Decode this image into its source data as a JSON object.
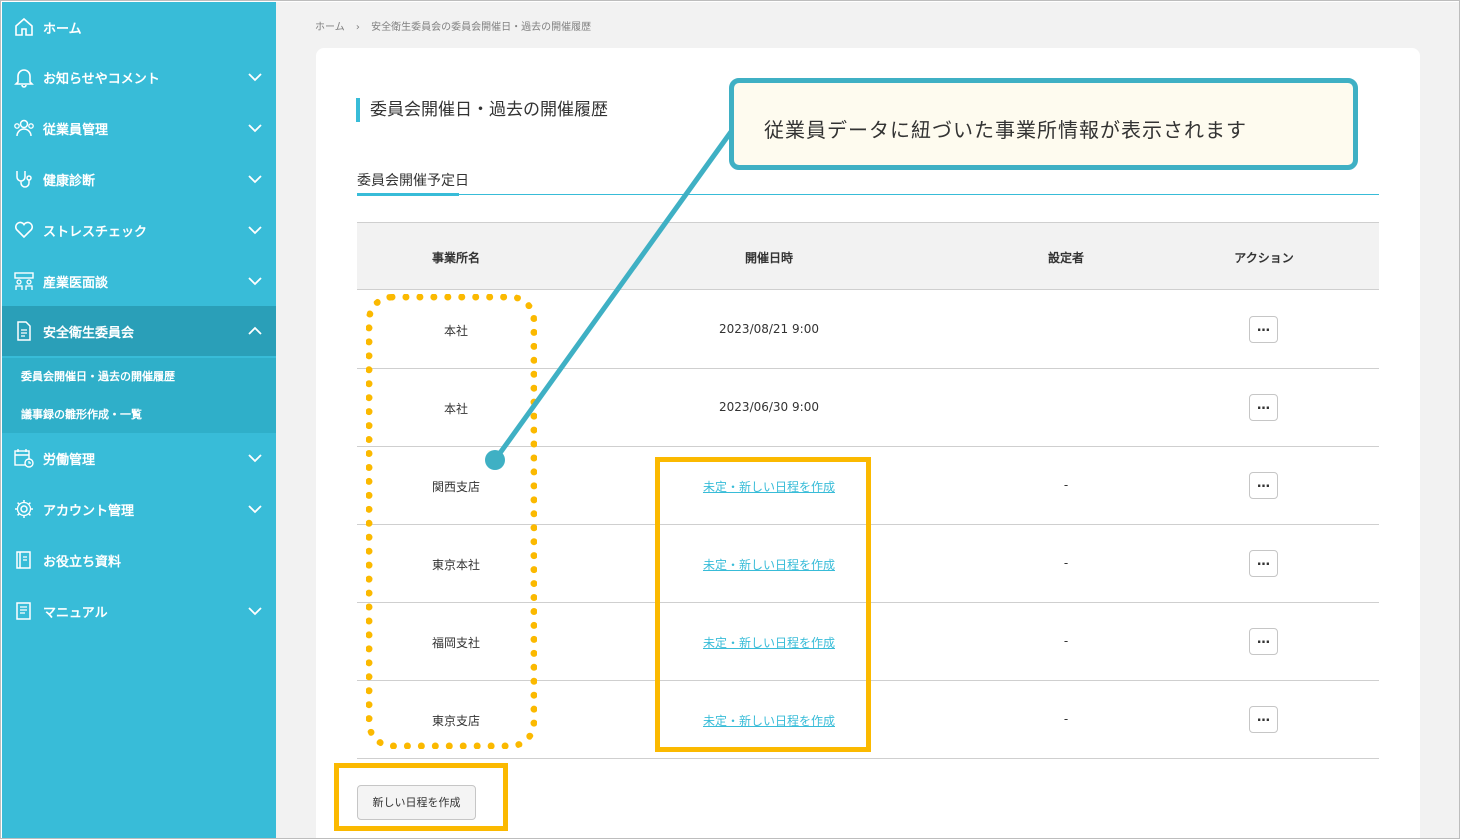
{
  "sidebar": {
    "items": [
      {
        "label": "ホーム",
        "icon": "home-icon"
      },
      {
        "label": "お知らせやコメント",
        "icon": "bell-icon"
      },
      {
        "label": "従業員管理",
        "icon": "users-icon"
      },
      {
        "label": "健康診断",
        "icon": "stethoscope-icon"
      },
      {
        "label": "ストレスチェック",
        "icon": "heart-icon"
      },
      {
        "label": "産業医面談",
        "icon": "meeting-icon"
      },
      {
        "label": "安全衛生委員会",
        "icon": "document-icon"
      },
      {
        "label": "労働管理",
        "icon": "calendar-clock-icon"
      },
      {
        "label": "アカウント管理",
        "icon": "gear-icon"
      },
      {
        "label": "お役立ち資料",
        "icon": "book-icon"
      },
      {
        "label": "マニュアル",
        "icon": "manual-icon"
      }
    ],
    "sub_items": [
      {
        "label": "委員会開催日・過去の開催履歴"
      },
      {
        "label": "議事録の雛形作成・一覧"
      }
    ]
  },
  "breadcrumb": {
    "home": "ホーム",
    "separator": "›",
    "current": "安全衛生委員会の委員会開催日・過去の開催履歴"
  },
  "page": {
    "title": "委員会開催日・過去の開催履歴",
    "section_title": "委員会開催予定日"
  },
  "table": {
    "headers": [
      "事業所名",
      "開催日時",
      "設定者",
      "アクション"
    ],
    "rows": [
      {
        "office": "本社",
        "datetime": "2023/08/21 9:00",
        "setter": "",
        "action": "…"
      },
      {
        "office": "本社",
        "datetime": "2023/06/30 9:00",
        "setter": "",
        "action": "…"
      },
      {
        "office": "関西支店",
        "datetime": "未定・新しい日程を作成",
        "setter": "-",
        "action": "…"
      },
      {
        "office": "東京本社",
        "datetime": "未定・新しい日程を作成",
        "setter": "-",
        "action": "…"
      },
      {
        "office": "福岡支社",
        "datetime": "未定・新しい日程を作成",
        "setter": "-",
        "action": "…"
      },
      {
        "office": "東京支店",
        "datetime": "未定・新しい日程を作成",
        "setter": "-",
        "action": "…"
      }
    ]
  },
  "new_schedule_button": "新しい日程を作成",
  "callout": {
    "text": "従業員データに紐づいた事業所情報が表示されます"
  },
  "colors": {
    "sidebar": "#38bcd8",
    "sidebar_active": "#2a9fb8",
    "accent": "#38bcd8",
    "highlight": "#fbb900",
    "callout_border": "#3fb0c4"
  }
}
